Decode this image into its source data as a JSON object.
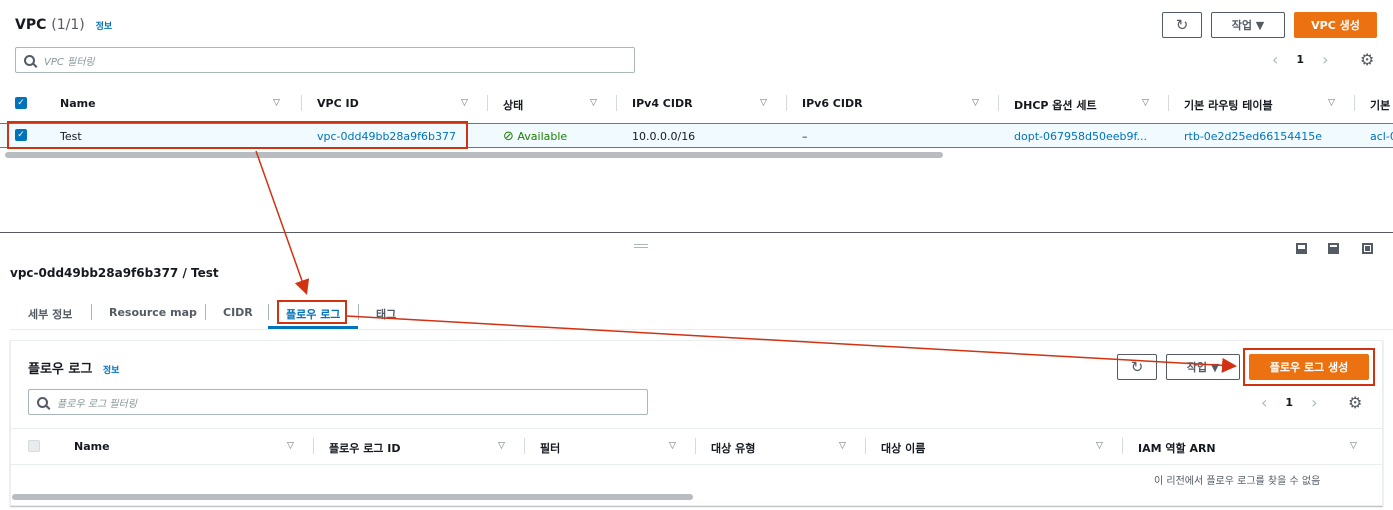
{
  "vpc_list": {
    "title": "VPC",
    "count": "(1/1)",
    "info": "정보",
    "refresh_icon": "refresh-icon",
    "actions_label": "작업 ▼",
    "create_label": "VPC 생성",
    "search_placeholder": "VPC 필터링",
    "page_number": "1",
    "columns": [
      "Name",
      "VPC ID",
      "상태",
      "IPv4 CIDR",
      "IPv6 CIDR",
      "DHCP 옵션 세트",
      "기본 라우팅 테이블",
      "기본"
    ],
    "row": {
      "name": "Test",
      "vpc_id": "vpc-0dd49bb28a9f6b377",
      "status": "Available",
      "ipv4": "10.0.0.0/16",
      "ipv6": "–",
      "dhcp": "dopt-067958d50eeb9f...",
      "route_table": "rtb-0e2d25ed66154415e",
      "acl": "acl-0"
    }
  },
  "detail": {
    "heading": "vpc-0dd49bb28a9f6b377 / Test",
    "tabs": [
      "세부 정보",
      "Resource map",
      "CIDR",
      "플로우 로그",
      "태그"
    ],
    "active_tab": 3
  },
  "flow_logs": {
    "title": "플로우 로그",
    "info": "정보",
    "actions_label": "작업 ▼",
    "create_label": "플로우 로그 생성",
    "search_placeholder": "플로우 로그 필터링",
    "page_number": "1",
    "columns": [
      "Name",
      "플로우 로그 ID",
      "필터",
      "대상 유형",
      "대상 이름",
      "IAM 역할 ARN"
    ],
    "empty_message": "이 리전에서 플로우 로그를 찾을 수 없음"
  },
  "colors": {
    "accent_orange": "#ec7211",
    "link_blue": "#0073bb",
    "highlight_red": "#d13212",
    "status_green": "#1d8102"
  }
}
